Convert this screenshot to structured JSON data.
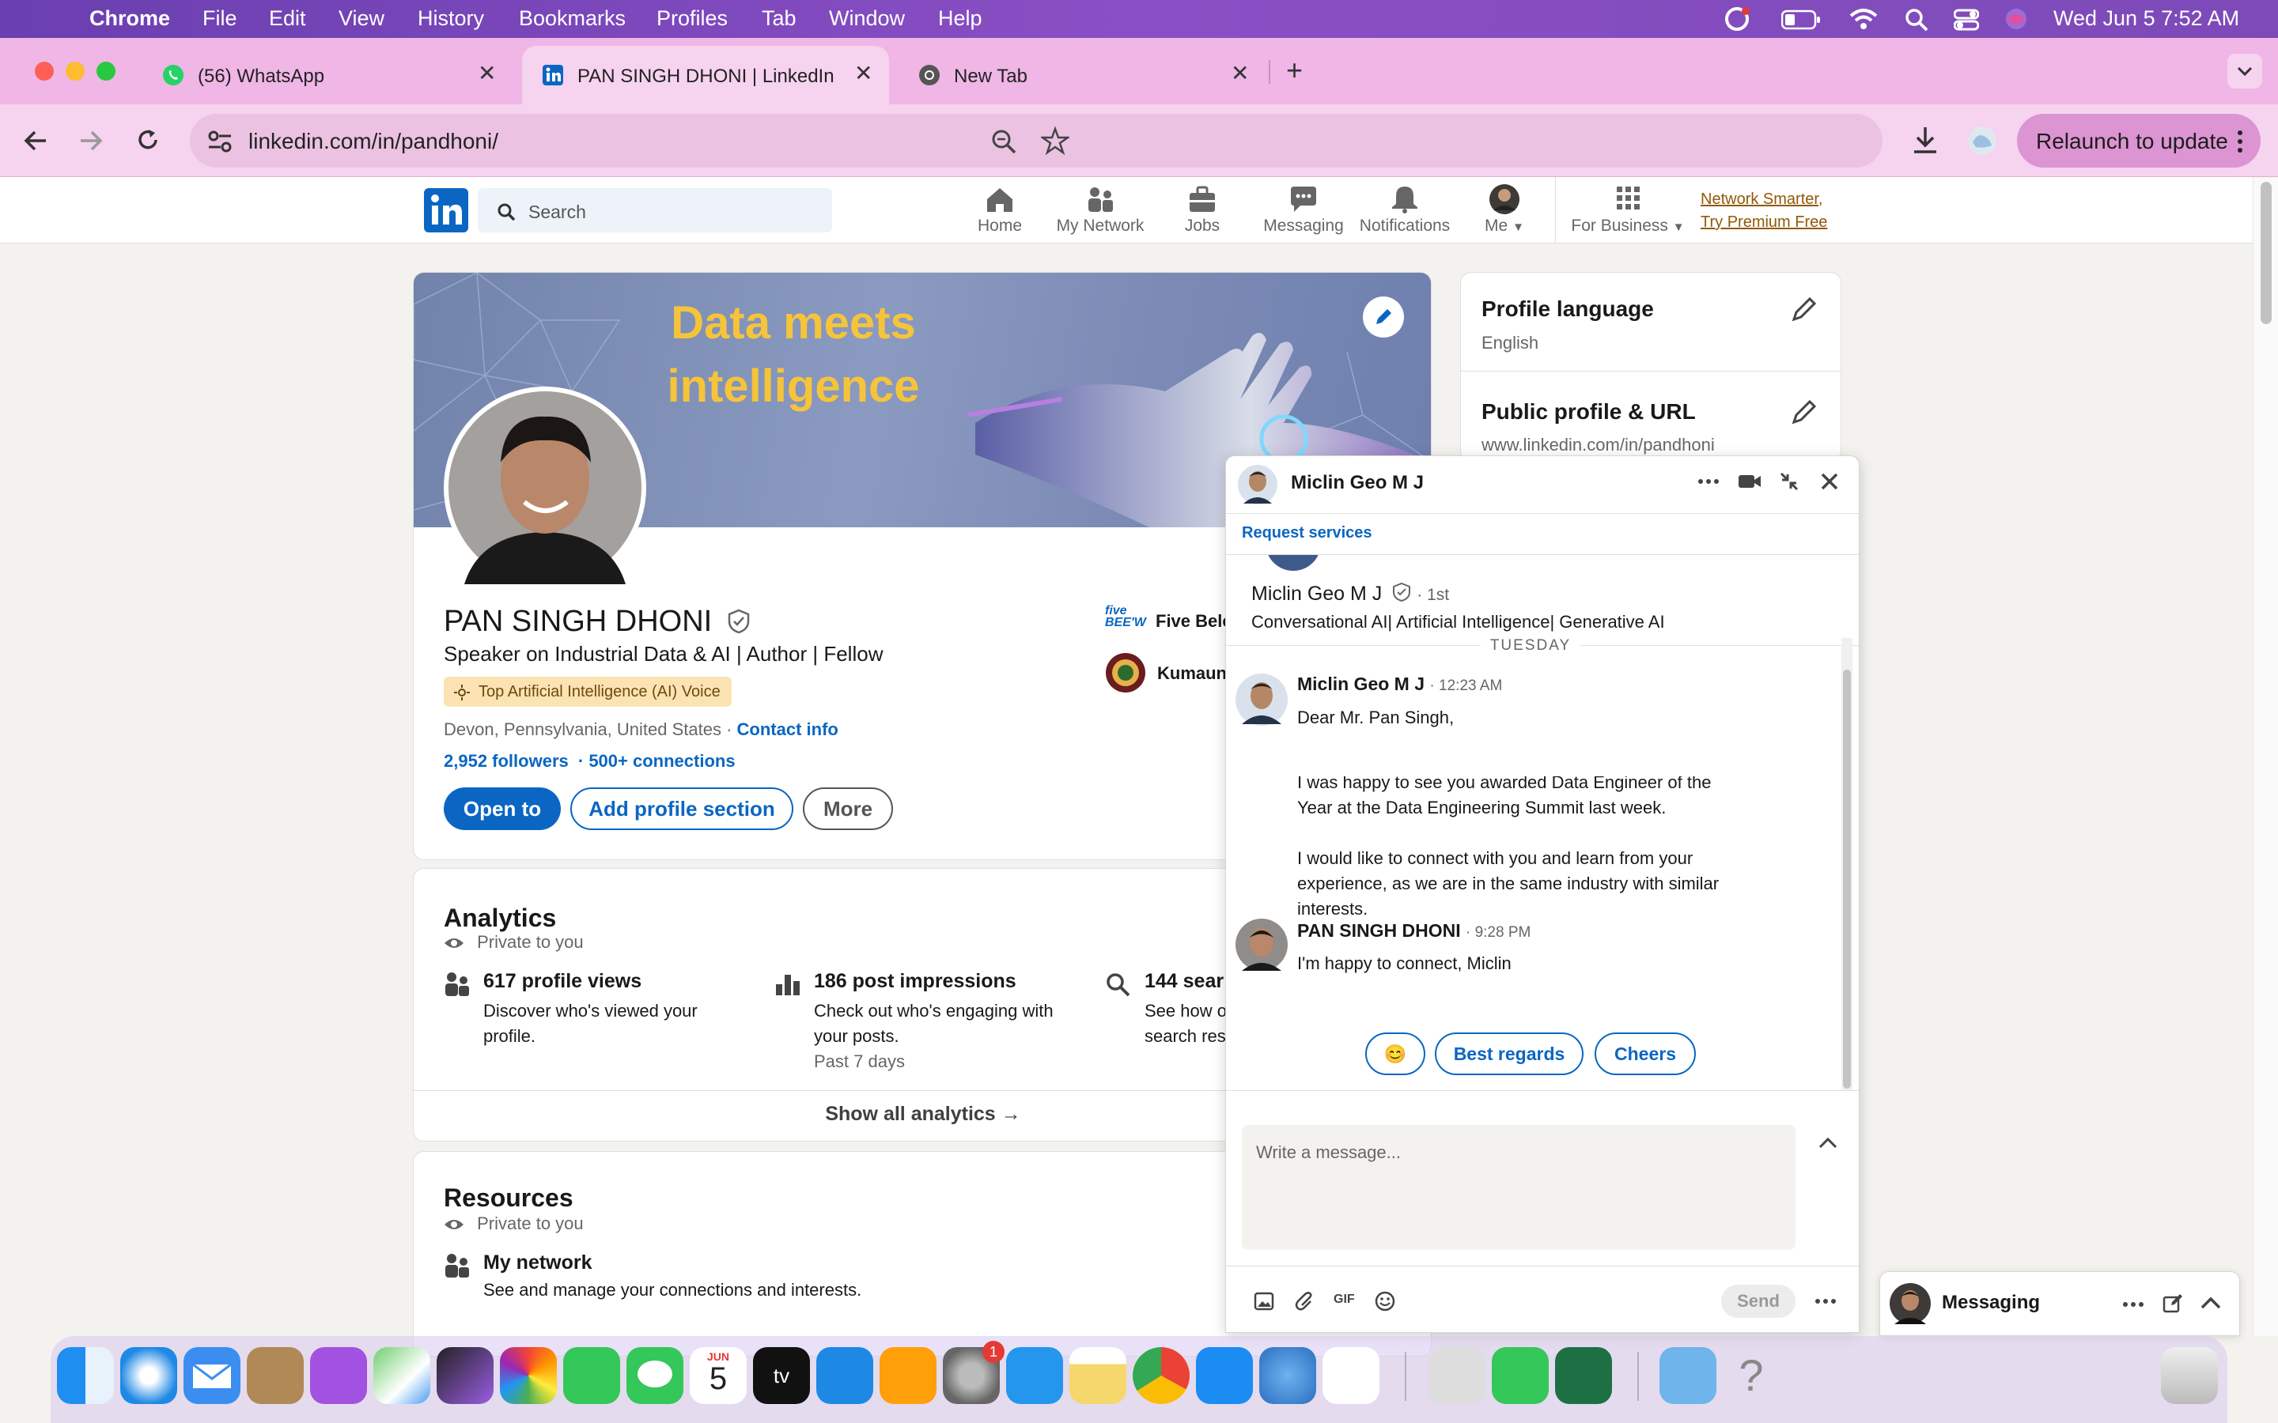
{
  "menubar": {
    "app": "Chrome",
    "items": [
      "File",
      "Edit",
      "View",
      "History",
      "Bookmarks",
      "Profiles",
      "Tab",
      "Window",
      "Help"
    ],
    "clock": "Wed Jun 5  7:52 AM"
  },
  "tabs": [
    {
      "title": "(56) WhatsApp"
    },
    {
      "title": "PAN SINGH DHONI | LinkedIn"
    },
    {
      "title": "New Tab"
    }
  ],
  "toolbar": {
    "url": "linkedin.com/in/pandhoni/",
    "relaunch": "Relaunch to update"
  },
  "lihead": {
    "search_placeholder": "Search",
    "nav": [
      "Home",
      "My Network",
      "Jobs",
      "Messaging",
      "Notifications",
      "Me",
      "For Business"
    ],
    "premium_line1": "Network Smarter,",
    "premium_line2": "Try Premium Free"
  },
  "profile": {
    "banner_line1": "Data meets",
    "banner_line2": "intelligence",
    "name": "PAN SINGH DHONI",
    "headline": "Speaker on Industrial Data & AI | Author | Fellow",
    "badge": "Top Artificial Intelligence (AI) Voice",
    "location": "Devon, Pennsylvania, United States",
    "location_sep": " · ",
    "contact": "Contact info",
    "followers": "2,952 followers",
    "connections": "· 500+ connections",
    "btn_open": "Open to",
    "btn_add": "Add profile section",
    "btn_more": "More",
    "company1": "Five Bele",
    "company1_logo": "five BEE'W",
    "company2": "Kumaun"
  },
  "analytics": {
    "title": "Analytics",
    "private": "Private to you",
    "items": [
      {
        "title": "617 profile views",
        "desc1": "Discover who's viewed your",
        "desc2": "profile.",
        "sub": ""
      },
      {
        "title": "186 post impressions",
        "desc1": "Check out who's engaging with",
        "desc2": "your posts.",
        "sub": "Past 7 days"
      },
      {
        "title": "144 sear",
        "desc1": "See how o",
        "desc2": "search res",
        "sub": ""
      }
    ],
    "show_all": "Show all analytics →"
  },
  "resources": {
    "title": "Resources",
    "private": "Private to you",
    "item_title": "My network",
    "item_desc": "See and manage your connections and interests."
  },
  "sidebar": {
    "lang_title": "Profile language",
    "lang_value": "English",
    "url_title": "Public profile & URL",
    "url_value": "www.linkedin.com/in/pandhoni"
  },
  "chat": {
    "contact": "Miclin Geo M J",
    "request": "Request services",
    "contact_degree": "· 1st",
    "contact_headline": "Conversational AI| Artificial Intelligence| Generative AI",
    "day": "TUESDAY",
    "msg1_sender": "Miclin Geo M J",
    "msg1_time": "· 12:23 AM",
    "msg1_p1": "Dear Mr. Pan Singh,",
    "msg1_p2a": "I was happy to see you awarded Data Engineer of the",
    "msg1_p2b": "Year at the Data Engineering Summit last week.",
    "msg1_p3a": "I would like to connect with you and learn from your",
    "msg1_p3b": "experience, as we are in the same industry with similar",
    "msg1_p3c": "interests.",
    "msg2_sender": "PAN SINGH DHONI",
    "msg2_time": "· 9:28 PM",
    "msg2_text": "I'm happy to connect, Miclin",
    "chip_emoji": "😊",
    "chip1": "Best regards",
    "chip2": "Cheers",
    "placeholder": "Write a message...",
    "send": "Send",
    "gif": "GIF"
  },
  "messaging_bar": {
    "label": "Messaging"
  },
  "dock": {
    "calendar_month": "JUN",
    "calendar_day": "5",
    "settings_badge": "1",
    "tv_label": "tv"
  }
}
